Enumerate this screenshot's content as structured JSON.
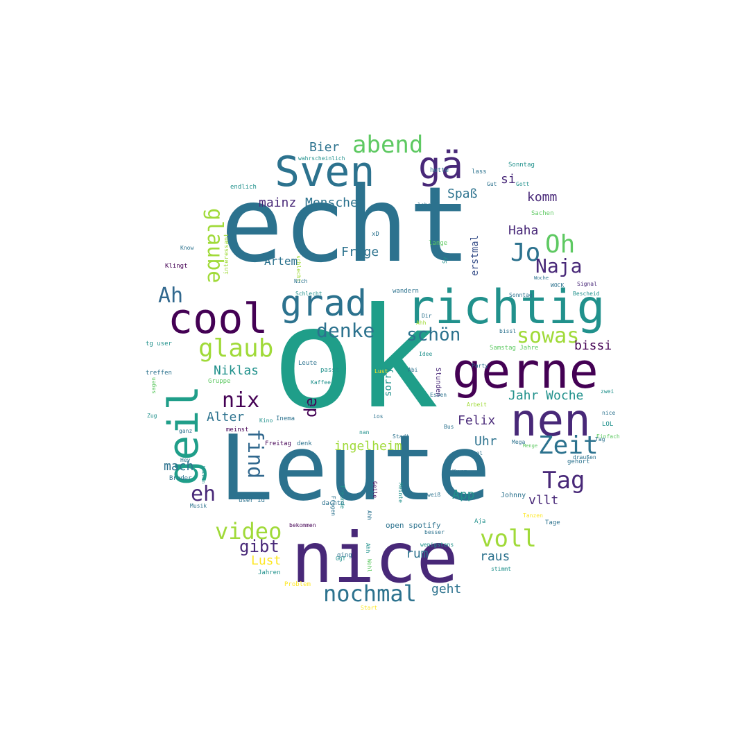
{
  "colors": {
    "background": "#ffffff",
    "palette": [
      "#440154",
      "#3b528b",
      "#21918c",
      "#2c728e",
      "#5ec962",
      "#a0da39",
      "#fde725",
      "#1f9e89",
      "#31688e",
      "#482878"
    ]
  },
  "words": [
    "ok",
    "echt",
    "Leute",
    "nice",
    "richtig",
    "gerne",
    "Sven",
    "cool",
    "grad",
    "nen",
    "geil",
    "gä",
    "abend",
    "Oh",
    "Jo",
    "Naja",
    "Zeit",
    "Tag",
    "glaube",
    "Ah",
    "denke",
    "sowas",
    "glaub",
    "schön",
    "nix",
    "find",
    "de",
    "eh",
    "video",
    "voll",
    "nochmal",
    "gibt",
    "bissi",
    "Niklas",
    "Alter",
    "Felix",
    "Uhr",
    "ingelheim",
    "Jahr Woche",
    "mach",
    "App",
    "vllt",
    "raus",
    "rum",
    "geht",
    "Lust",
    "Bier",
    "mainz",
    "Menschen",
    "Spaß",
    "komm",
    "si",
    "Frage",
    "Artem",
    "Haha",
    "erstmal",
    "sorry",
    "Kurz",
    "open spotify",
    "Johnny",
    "Aja",
    "endlich",
    "Jahren",
    "Problem",
    "Signal",
    "Bescheid",
    "passt",
    "Idee",
    "Stunden",
    "Musik",
    "user id",
    "Woche",
    "Samstag Jahre",
    "Sonntag",
    "Sachen",
    "treffen",
    "Gruppe",
    "Freitag",
    "denk",
    "Bruder",
    "Wochen",
    "gehört",
    "Menge",
    "LOL",
    "Arbeit",
    "meinst",
    "ging",
    "Start",
    "bekommen",
    "Tage",
    "Ahh",
    "Kino",
    "wahrscheinlich",
    "hotte",
    "lass",
    "leben",
    "lange",
    "interessant",
    "Leute",
    "Klingt",
    "nan",
    "ios",
    "Ahh",
    "tg user",
    "xD",
    "Dir",
    "zwei",
    "wandern",
    "dachte",
    "Freunde",
    "stimmt",
    "Fragen",
    "Meinte",
    "Geile",
    "Ggf",
    "Wohl",
    "schlecht",
    "Inema",
    "WOCK",
    "Sy",
    "Einfach",
    "Mega",
    "nice",
    "sagen",
    "ganz",
    "weiß",
    "besser",
    "wenigstens",
    "draußen",
    "Tanzen",
    "Tag",
    "Schlecht",
    "Sonntag",
    "Hey",
    "Abi",
    "Ahh",
    "Nich",
    "Essen",
    "Know",
    "Gut",
    "Zug",
    "Gott",
    "bissl",
    "Spiel",
    "Bus",
    "Kaffee",
    "Stadt",
    "Party",
    "Lust",
    "Zug"
  ]
}
